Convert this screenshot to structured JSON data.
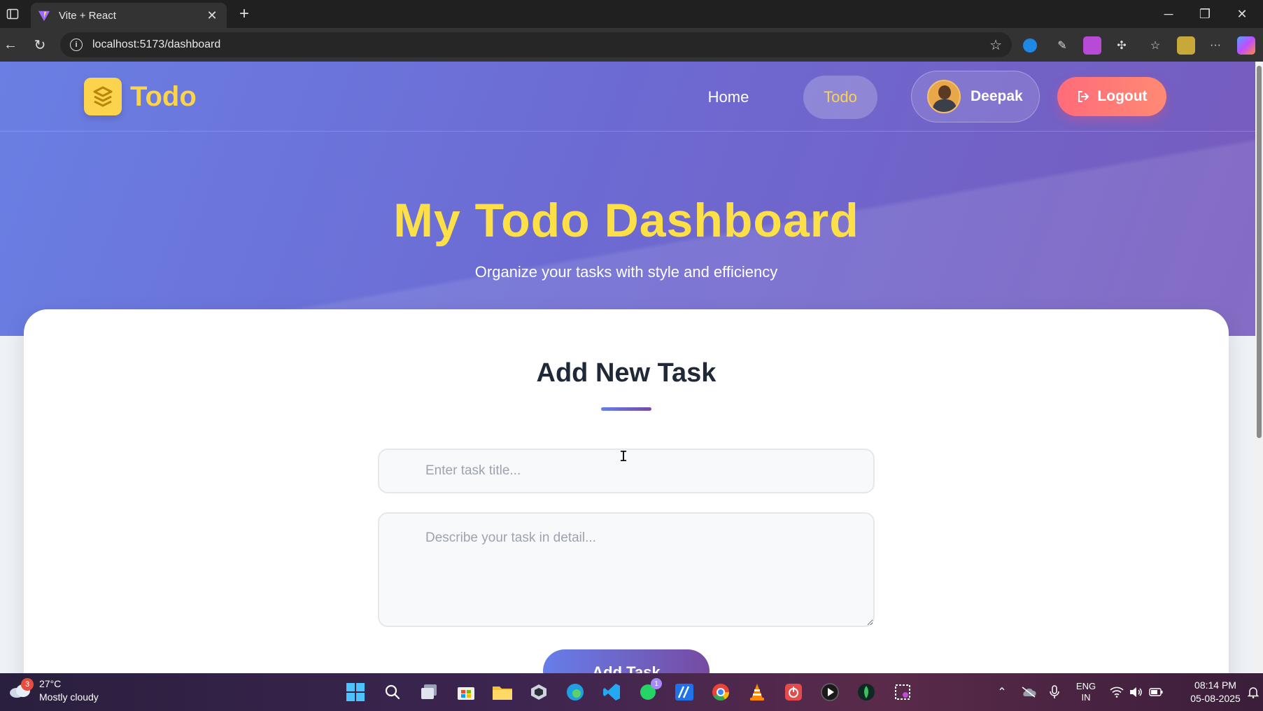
{
  "browser": {
    "tab_title": "Vite + React",
    "url": "localhost:5173/dashboard"
  },
  "navbar": {
    "logo_text": "Todo",
    "home_label": "Home",
    "todo_label": "Todo",
    "user_name": "Deepak",
    "logout_label": "Logout"
  },
  "hero": {
    "title": "My Todo Dashboard",
    "subtitle": "Organize your tasks with style and efficiency"
  },
  "form": {
    "heading": "Add New Task",
    "title_placeholder": "Enter task title...",
    "description_placeholder": "Describe your task in detail...",
    "submit_label": "Add Task"
  },
  "taskbar": {
    "weather_temp": "27°C",
    "weather_desc": "Mostly cloudy",
    "weather_badge": "3",
    "whatsapp_badge": "1",
    "lang_line1": "ENG",
    "lang_line2": "IN",
    "time": "08:14 PM",
    "date": "05-08-2025"
  },
  "colors": {
    "hero_gradient_start": "#6a7fe3",
    "hero_gradient_end": "#775bbd",
    "accent_yellow": "#fcd34d",
    "logout_red": "#ff6b7a"
  }
}
